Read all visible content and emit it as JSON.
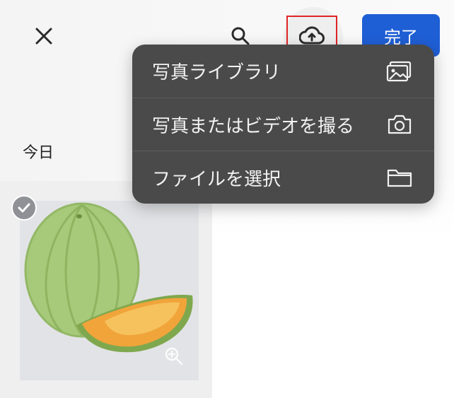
{
  "header": {
    "close_icon": "close-icon",
    "search_icon": "search-icon",
    "upload_icon": "cloud-upload-icon",
    "done_label": "完了",
    "accent_color": "#1f5fd6",
    "highlight_color": "#e02424"
  },
  "section": {
    "title": "今日"
  },
  "upload_menu": {
    "items": [
      {
        "label": "写真ライブラリ",
        "icon": "photo-library-icon"
      },
      {
        "label": "写真またはビデオを撮る",
        "icon": "camera-icon"
      },
      {
        "label": "ファイルを選択",
        "icon": "folder-icon"
      }
    ]
  },
  "grid": {
    "items": [
      {
        "subject": "melon",
        "selected": true,
        "zoom_icon": "zoom-in-icon"
      }
    ]
  }
}
